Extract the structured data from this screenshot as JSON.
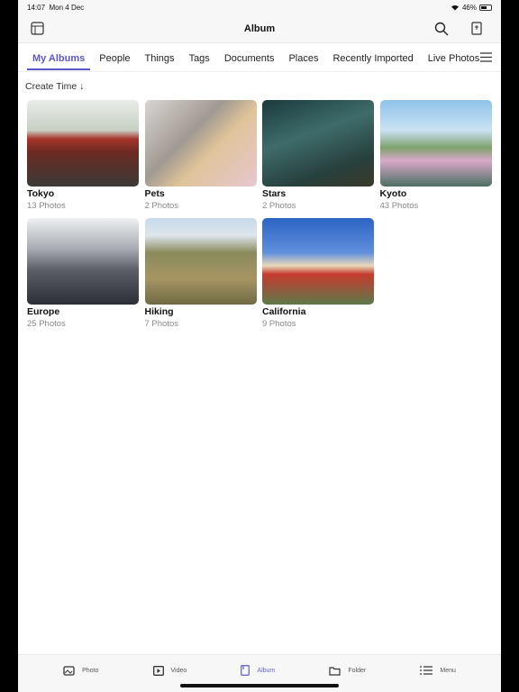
{
  "status": {
    "time": "14:07",
    "date": "Mon 4 Dec",
    "battery": "46%",
    "battery_level": 0.46
  },
  "nav": {
    "title": "Album",
    "left_icon": "sidebar-icon",
    "right_icons": [
      "search-icon",
      "import-icon"
    ]
  },
  "tabs": [
    {
      "label": "My Albums",
      "active": true
    },
    {
      "label": "People"
    },
    {
      "label": "Things"
    },
    {
      "label": "Tags"
    },
    {
      "label": "Documents"
    },
    {
      "label": "Places"
    },
    {
      "label": "Recently Imported"
    },
    {
      "label": "Live Photos"
    }
  ],
  "sort": {
    "label": "Create Time ↓"
  },
  "albums": [
    {
      "name": "Tokyo",
      "count": "13 Photos"
    },
    {
      "name": "Pets",
      "count": "2 Photos"
    },
    {
      "name": "Stars",
      "count": "2 Photos"
    },
    {
      "name": "Kyoto",
      "count": "43 Photos"
    },
    {
      "name": "Europe",
      "count": "25 Photos"
    },
    {
      "name": "Hiking",
      "count": "7 Photos"
    },
    {
      "name": "California",
      "count": "9 Photos"
    }
  ],
  "bottom_tabs": [
    {
      "label": "Photo"
    },
    {
      "label": "Video"
    },
    {
      "label": "Album",
      "active": true
    },
    {
      "label": "Folder"
    },
    {
      "label": "Menu"
    }
  ],
  "colors": {
    "accent": "#5b57c9"
  }
}
